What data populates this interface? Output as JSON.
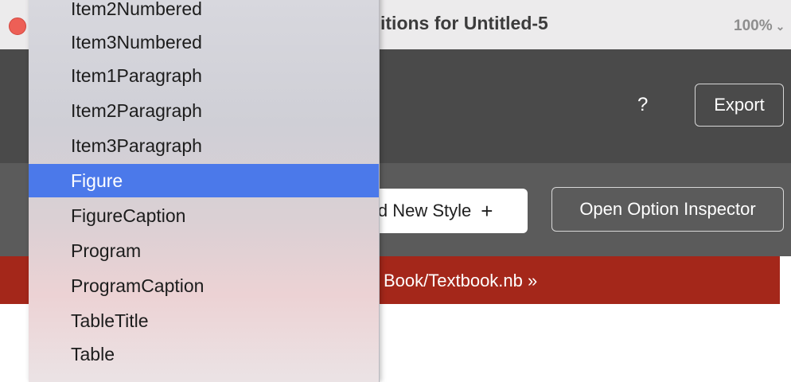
{
  "window": {
    "title": "itions for Untitled-5",
    "zoom": "100%",
    "zoom_chevron": "⌄"
  },
  "header": {
    "help_label": "?",
    "export_label": "Export"
  },
  "toolbar": {
    "add_style_label": "ld New Style",
    "add_style_icon": "+",
    "inspector_label": "Open Option Inspector"
  },
  "banner": {
    "path_text": "Book/Textbook.nb »"
  },
  "menu": {
    "items": [
      {
        "label": "Item2Numbered"
      },
      {
        "label": "Item3Numbered"
      },
      {
        "label": "Item1Paragraph"
      },
      {
        "label": "Item2Paragraph"
      },
      {
        "label": "Item3Paragraph"
      },
      {
        "label": "Figure",
        "selected": true
      },
      {
        "label": "FigureCaption"
      },
      {
        "label": "Program"
      },
      {
        "label": "ProgramCaption"
      },
      {
        "label": "TableTitle"
      },
      {
        "label": "Table"
      }
    ]
  },
  "colors": {
    "selection": "#4b79ea",
    "banner": "#a4271a",
    "header": "#4a4a4a"
  }
}
